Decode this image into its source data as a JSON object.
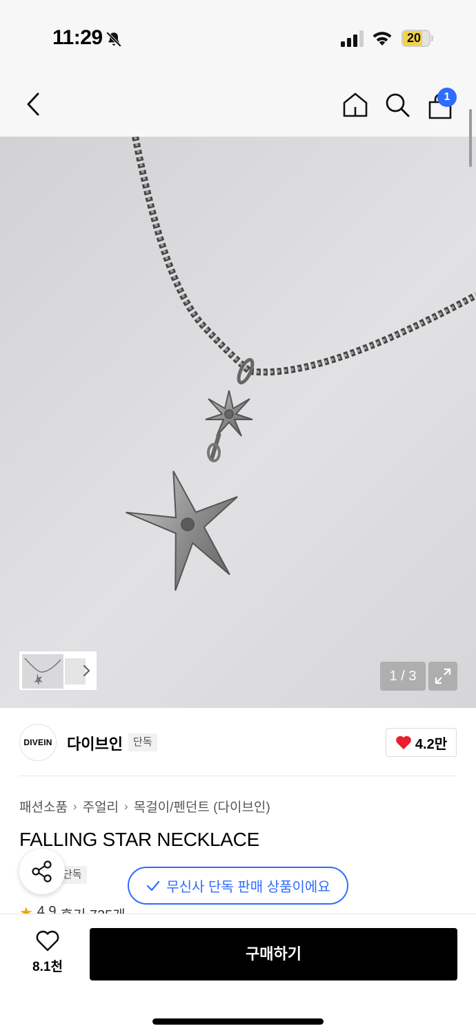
{
  "status_bar": {
    "time": "11:29",
    "battery": "20",
    "icons": [
      "bell-slash-icon",
      "signal-icon",
      "wifi-icon",
      "battery-icon"
    ]
  },
  "nav": {
    "cart_count": "1",
    "icons": [
      "back-arrow-icon",
      "home-icon",
      "search-icon",
      "cart-icon"
    ]
  },
  "gallery": {
    "counter": "1 / 3",
    "current_page": 1,
    "total_pages": 3
  },
  "brand": {
    "logo_text": "DIVEIN",
    "name": "다이브인",
    "tag": "단독",
    "likes": "4.2만"
  },
  "breadcrumb": [
    "패션소품",
    "주얼리",
    "목걸이/펜던트 (다이브인)"
  ],
  "product": {
    "title": "FALLING STAR NECKLACE",
    "exclusive_tag": "단독",
    "exclusive_notice": "무신사 단독 판매 상품이에요",
    "rating": "4.9",
    "reviews": "후기 735개"
  },
  "bottom": {
    "wish_count": "8.1천",
    "buy_label": "구매하기"
  },
  "colors": {
    "accent_blue": "#2f6bff",
    "heart_red": "#e8202a",
    "star_orange": "#f5a200",
    "buy_bg": "#000000"
  }
}
